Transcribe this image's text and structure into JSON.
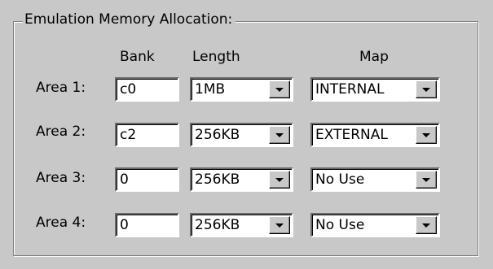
{
  "group": {
    "title": "Emulation Memory Allocation:"
  },
  "columns": {
    "bank": "Bank",
    "length": "Length",
    "map": "Map"
  },
  "rows": [
    {
      "label": "Area 1:",
      "bank": "c0",
      "length": "1MB",
      "map": "INTERNAL"
    },
    {
      "label": "Area 2:",
      "bank": "c2",
      "length": "256KB",
      "map": "EXTERNAL"
    },
    {
      "label": "Area 3:",
      "bank": "0",
      "length": "256KB",
      "map": "No Use"
    },
    {
      "label": "Area 4:",
      "bank": "0",
      "length": "256KB",
      "map": "No Use"
    }
  ],
  "icons": {
    "dropdown": "chevron-down-icon"
  }
}
